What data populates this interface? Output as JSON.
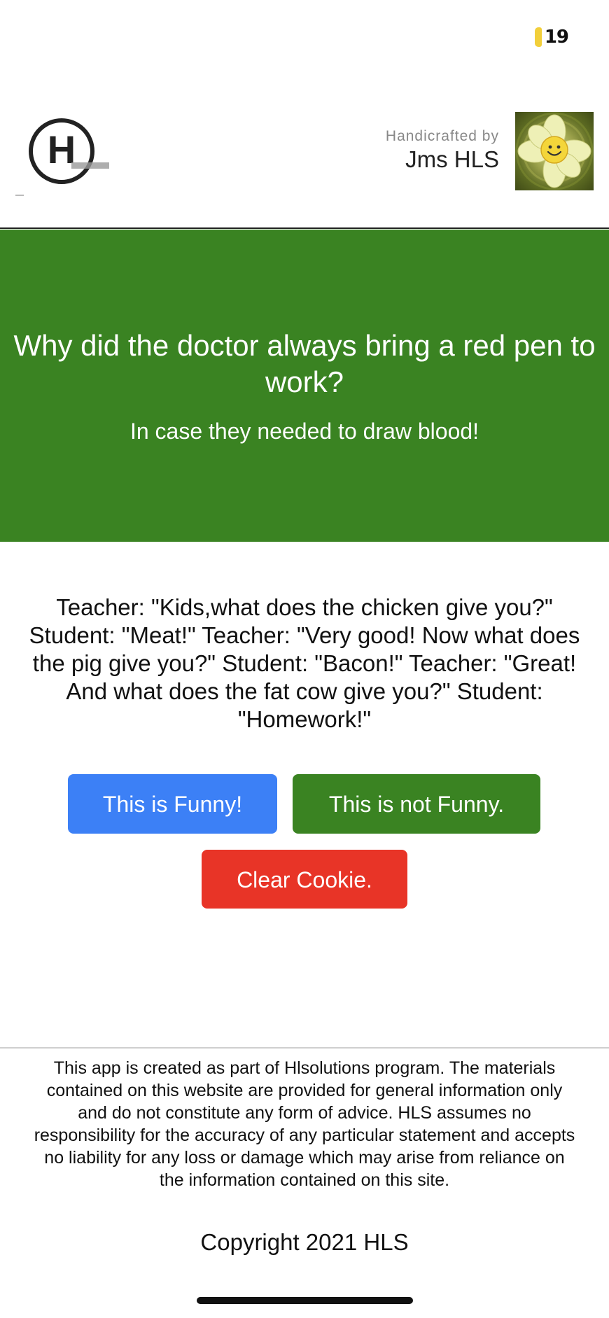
{
  "status_bar": {
    "battery_level": "19",
    "battery_color": "#f2cf3a"
  },
  "header": {
    "logo_letter": "H",
    "credit_label": "Handicrafted by",
    "credit_name": "Jms HLS",
    "avatar_icon": "smiling-daffodil-icon"
  },
  "hero": {
    "background_color": "#3a8322",
    "question": "Why did the doctor always bring a red pen to work?",
    "answer": "In case they needed to draw blood!"
  },
  "joke": {
    "text": "Teacher: \"Kids,what does the chicken give you?\" Student: \"Meat!\" Teacher: \"Very good! Now what does the pig give you?\" Student: \"Bacon!\" Teacher: \"Great! And what does the fat cow give you?\" Student: \"Homework!\""
  },
  "buttons": {
    "funny_label": "This is Funny!",
    "funny_color": "#3c80f6",
    "not_funny_label": "This is not Funny.",
    "not_funny_color": "#3a8322",
    "clear_label": "Clear Cookie.",
    "clear_color": "#e83427"
  },
  "footer": {
    "disclaimer": "This app is created as part of Hlsolutions program. The materials contained on this website are provided for general information only and do not constitute any form of advice. HLS assumes no responsibility for the accuracy of any particular statement and accepts no liability for any loss or damage which may arise from reliance on the information contained on this site.",
    "copyright": "Copyright 2021 HLS"
  }
}
